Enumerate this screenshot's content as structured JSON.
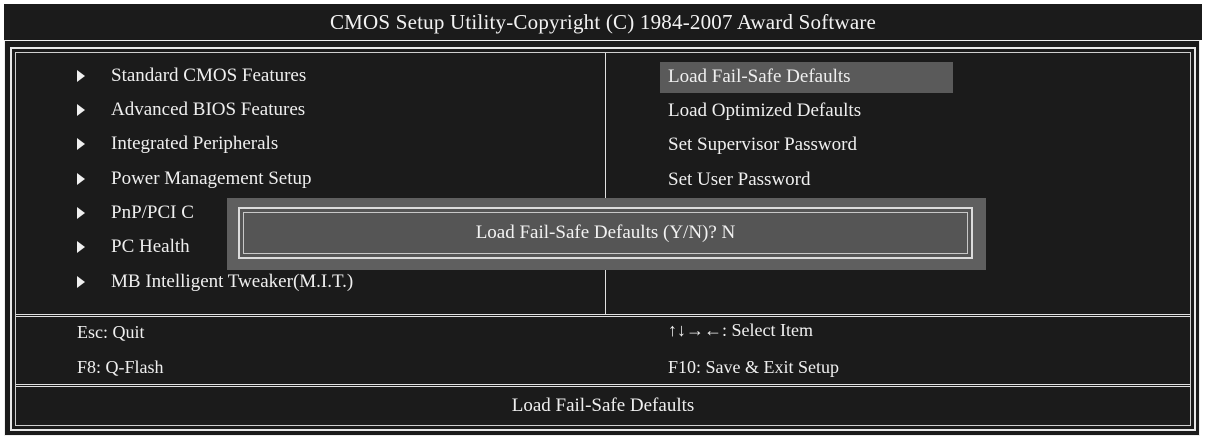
{
  "title": "CMOS Setup Utility-Copyright (C) 1984-2007 Award Software",
  "left_menu": [
    {
      "label": "Standard CMOS Features"
    },
    {
      "label": "Advanced BIOS Features"
    },
    {
      "label": "Integrated Peripherals"
    },
    {
      "label": "Power Management Setup"
    },
    {
      "label": "PnP/PCI C"
    },
    {
      "label": "PC Health"
    },
    {
      "label": "MB Intelligent Tweaker(M.I.T.)"
    }
  ],
  "right_menu": [
    {
      "label": "Load Fail-Safe Defaults",
      "selected": true
    },
    {
      "label": "Load Optimized Defaults"
    },
    {
      "label": "Set Supervisor Password"
    },
    {
      "label": "Set User Password"
    }
  ],
  "dialog": {
    "prompt": "Load Fail-Safe Defaults (Y/N)? N"
  },
  "help": {
    "esc": "Esc: Quit",
    "f8": "F8: Q-Flash",
    "select": "↑↓→←: Select Item",
    "f10": "F10: Save & Exit Setup"
  },
  "status_line": "Load Fail-Safe Defaults",
  "colors": {
    "background": "#1b1b1b",
    "highlight": "#5a5a5a",
    "text": "#efefef"
  }
}
